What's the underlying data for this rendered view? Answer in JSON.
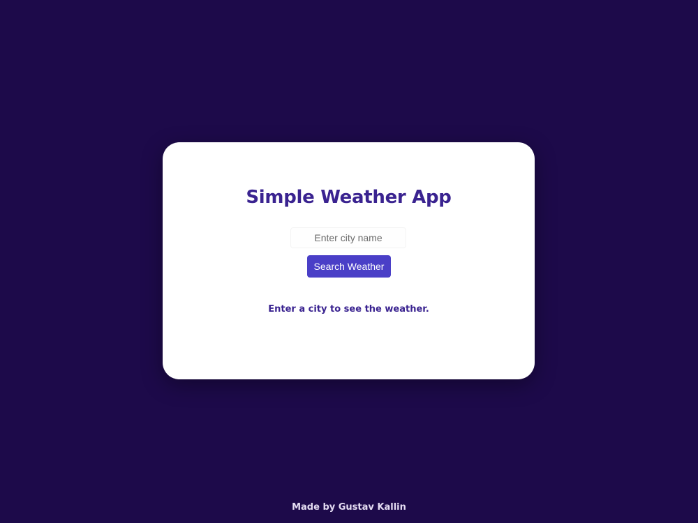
{
  "app": {
    "title": "Simple Weather App"
  },
  "search": {
    "input_value": "",
    "placeholder": "Enter city name",
    "button_label": "Search Weather"
  },
  "status": {
    "message": "Enter a city to see the weather."
  },
  "footer": {
    "credit": "Made by Gustav Kallin"
  },
  "colors": {
    "background": "#1d0a4a",
    "card": "#ffffff",
    "accent": "#4a3fc7",
    "title_text": "#3a2390",
    "footer_text": "#e4dcf2"
  }
}
